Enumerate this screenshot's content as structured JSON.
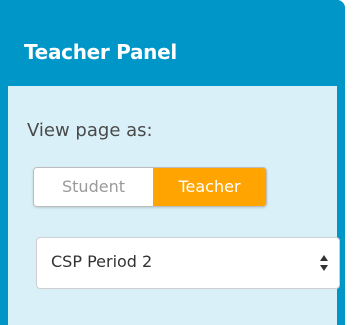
{
  "panel": {
    "title": "Teacher Panel",
    "view_label": "View page as:"
  },
  "view_toggle": {
    "options": [
      "Student",
      "Teacher"
    ],
    "selected": "Teacher"
  },
  "section_select": {
    "value": "CSP Period 2"
  },
  "icons": {
    "select_arrows": "up-down-chevron-icon"
  },
  "colors": {
    "header_blue": "#0096c7",
    "body_light_blue": "#d9f0f8",
    "active_orange": "#ffa400"
  }
}
